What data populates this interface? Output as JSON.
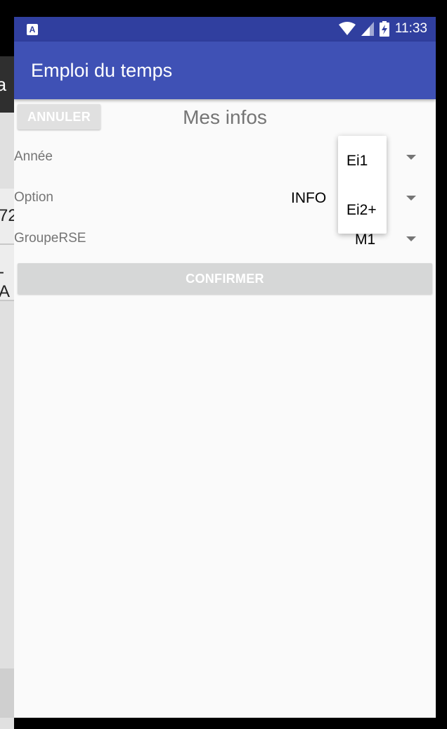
{
  "background_activity": {
    "toolbar_fragment": "ra",
    "row1_fragment": "72",
    "row2_fragment": "- A"
  },
  "status_bar": {
    "time": "11:33",
    "app_icon": "A"
  },
  "app_bar": {
    "title": "Emploi du temps"
  },
  "form": {
    "cancel_label": "ANNULER",
    "title": "Mes infos",
    "annee": {
      "label": "Année",
      "value": ""
    },
    "option": {
      "label": "Option",
      "value": "INFO"
    },
    "groupe": {
      "label": "GroupeRSE",
      "value": "M1"
    },
    "confirm_label": "CONFIRMER"
  },
  "dropdown": {
    "options": [
      "Ei1",
      "Ei2+"
    ]
  },
  "colors": {
    "status_bar": "#303f9f",
    "app_bar": "#3f51b5",
    "button_disabled": "#d6d7d7"
  },
  "icons": [
    "wifi-icon",
    "signal-icon",
    "battery-charging-icon",
    "dropdown-caret-icon"
  ]
}
